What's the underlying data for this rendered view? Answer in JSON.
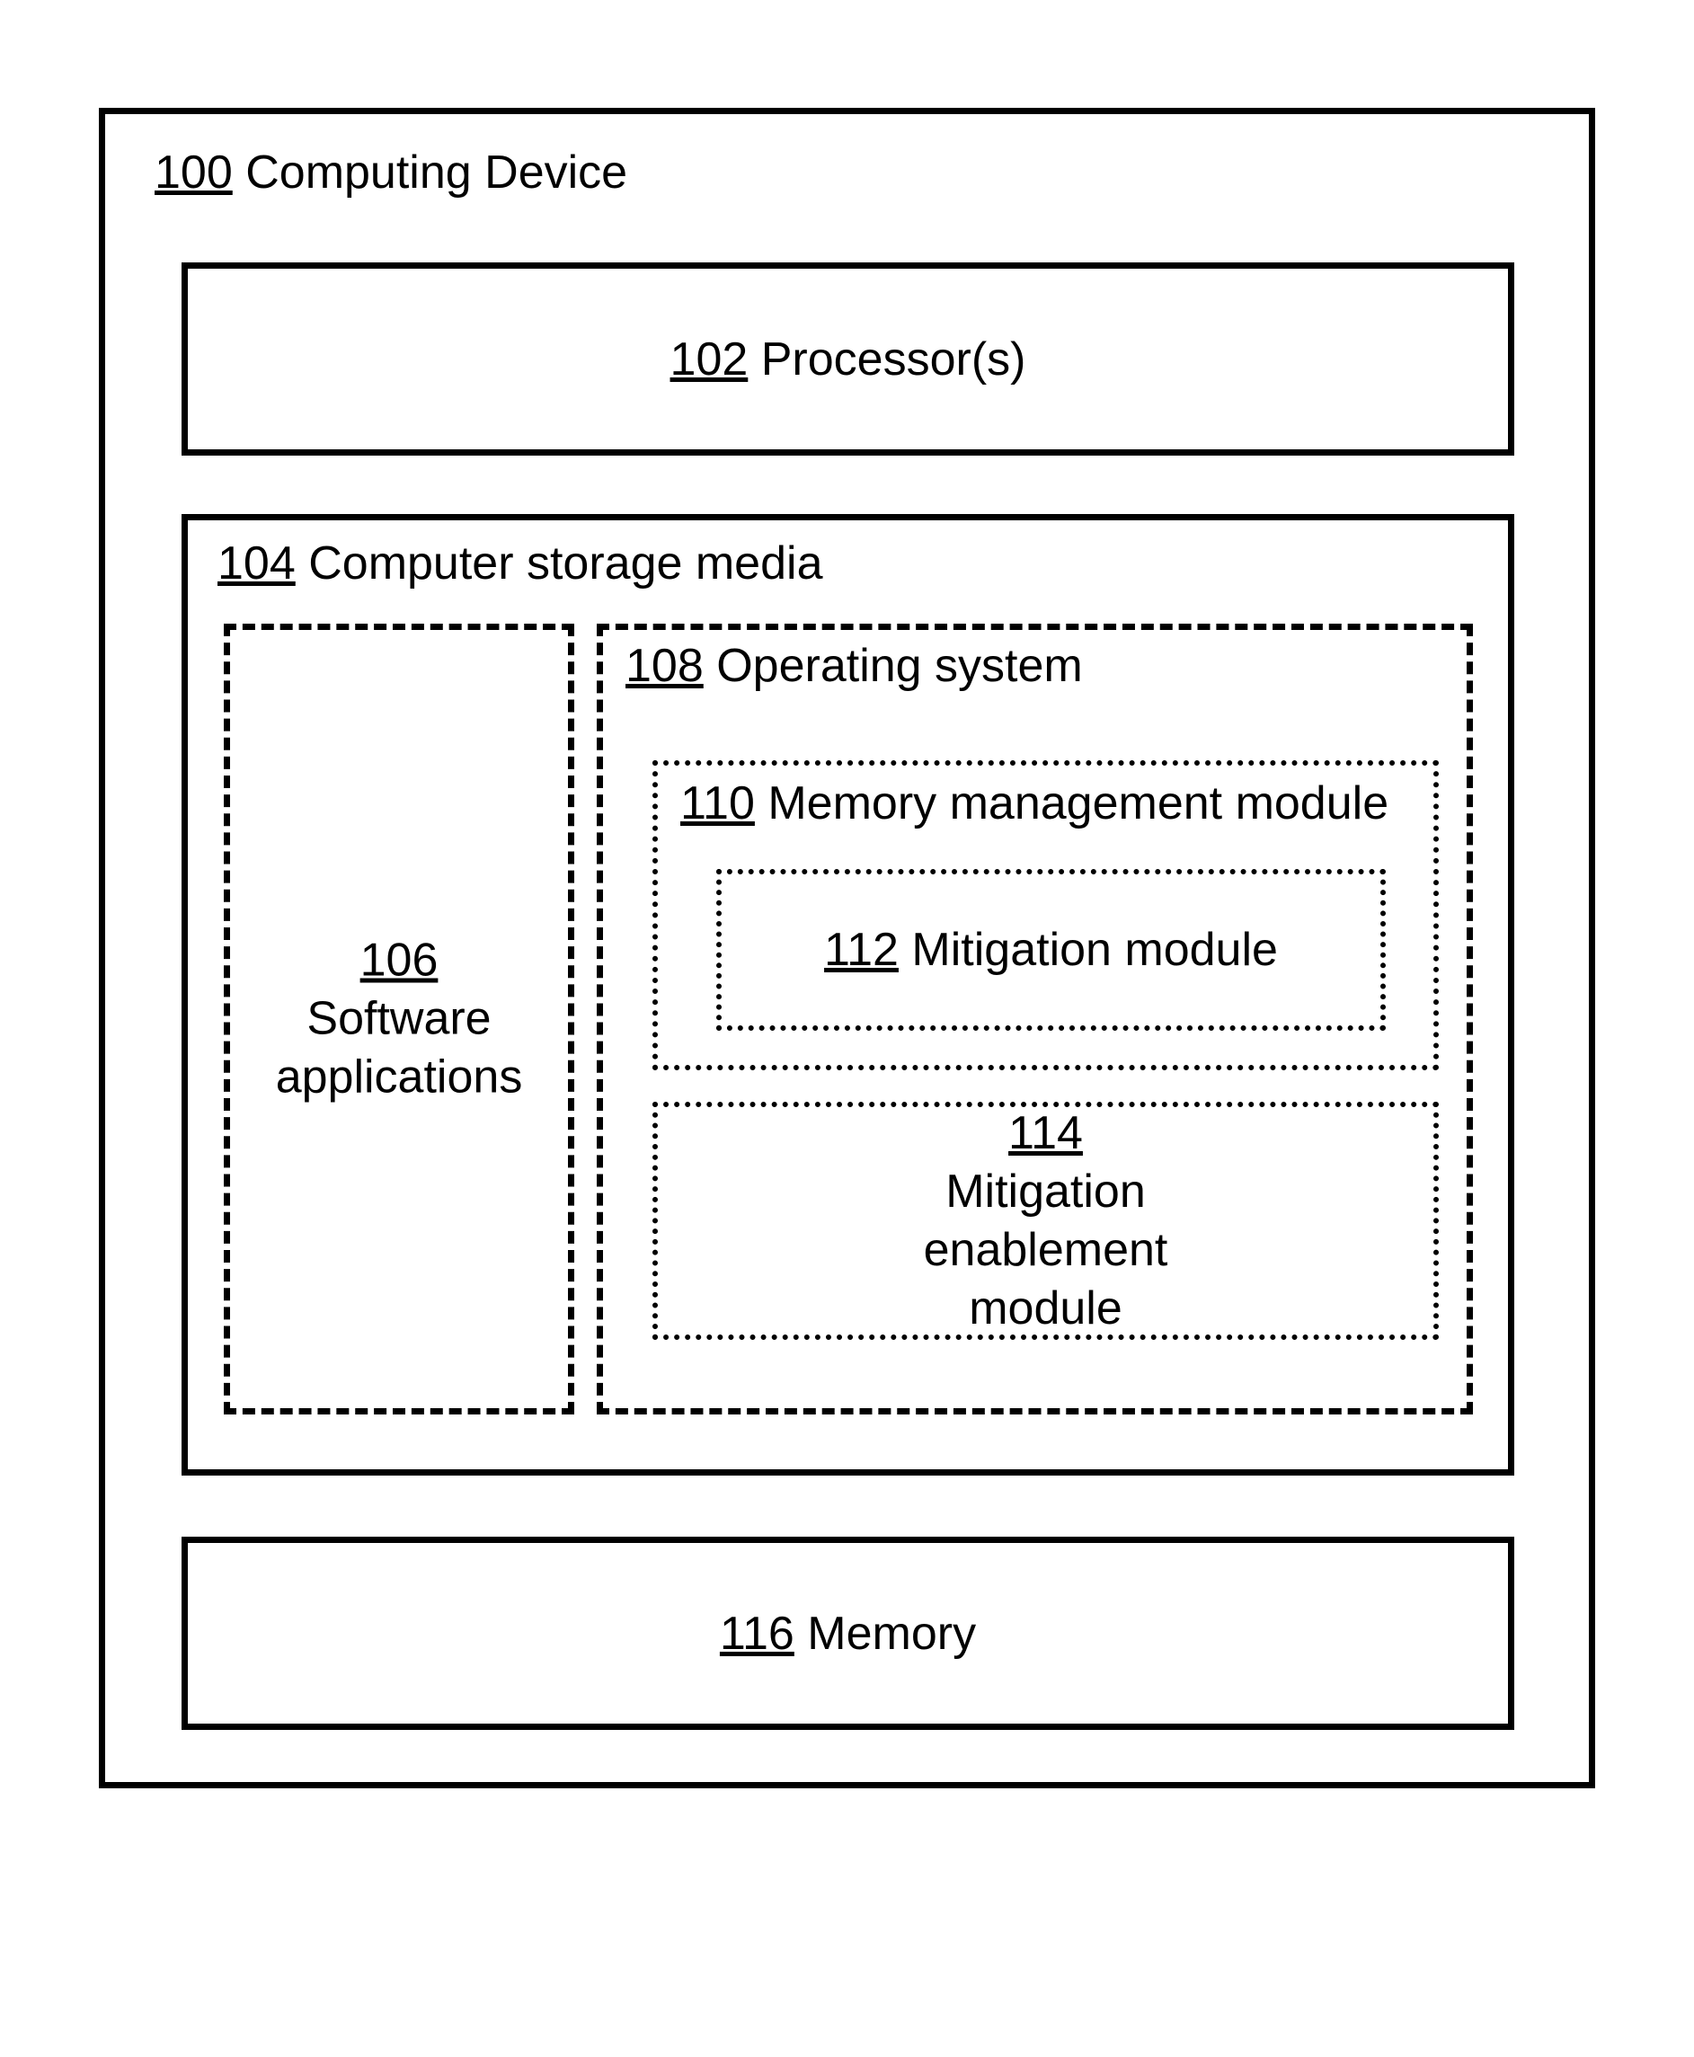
{
  "blocks": {
    "device": {
      "ref": "100",
      "name": "Computing Device"
    },
    "processor": {
      "ref": "102",
      "name": "Processor(s)"
    },
    "storage": {
      "ref": "104",
      "name": "Computer storage media"
    },
    "apps": {
      "ref": "106",
      "name": "Software applications"
    },
    "os": {
      "ref": "108",
      "name": "Operating system"
    },
    "mmm": {
      "ref": "110",
      "name": "Memory management module"
    },
    "mit": {
      "ref": "112",
      "name": "Mitigation module"
    },
    "mem": {
      "ref": "114",
      "name": "Mitigation enablement module"
    },
    "memory": {
      "ref": "116",
      "name": "Memory"
    }
  }
}
